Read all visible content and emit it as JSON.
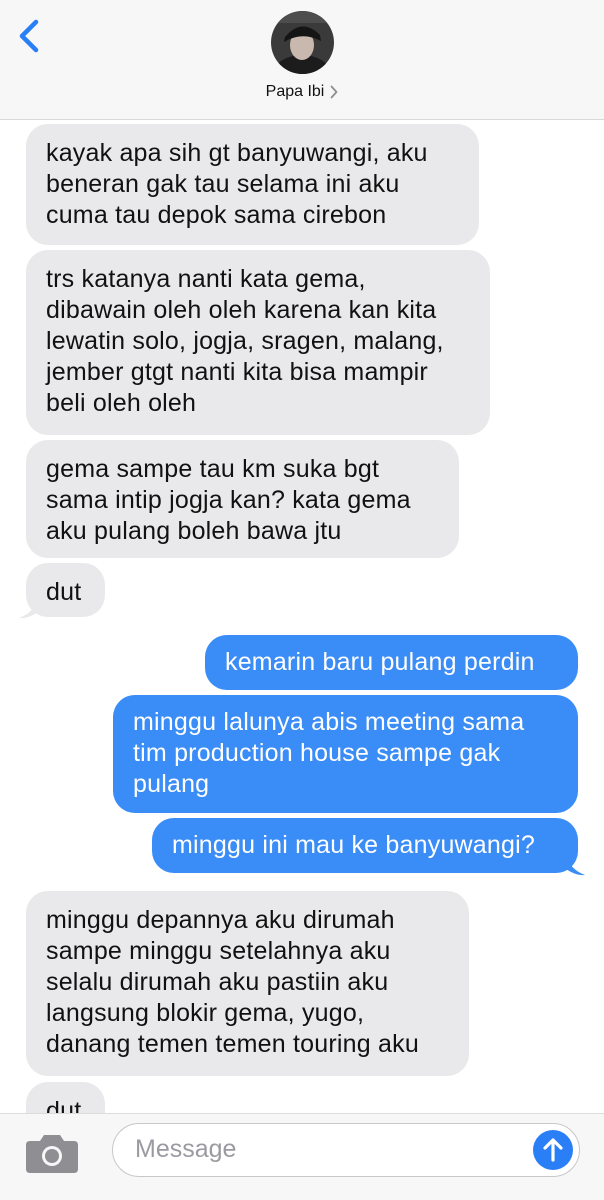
{
  "header": {
    "contact_name": "Papa Ibi",
    "back_icon": "chevron-left-icon",
    "accent": "#2a7ff6"
  },
  "messages": [
    {
      "dir": "in",
      "text": "kayak apa sih gt banyuwangi, aku\nbeneran gak tau selama ini aku\ncuma tau depok sama cirebon"
    },
    {
      "dir": "in",
      "text": "trs katanya nanti kata gema,\ndibawain oleh oleh karena kan kita\nlewatin solo, jogja, sragen, malang,\njember gtgt nanti kita bisa mampir\nbeli oleh oleh"
    },
    {
      "dir": "in",
      "text": "gema sampe tau km suka bgt\nsama intip jogja kan? kata gema\naku pulang boleh bawa jtu"
    },
    {
      "dir": "in",
      "text": "dut"
    },
    {
      "dir": "out",
      "text": "kemarin baru pulang perdin"
    },
    {
      "dir": "out",
      "text": "minggu lalunya abis meeting sama\ntim production house sampe gak\npulang"
    },
    {
      "dir": "out",
      "text": "minggu ini mau ke banyuwangi?"
    },
    {
      "dir": "in",
      "text": "minggu depannya aku dirumah\nsampe minggu setelahnya aku\nselalu dirumah aku pastiin aku\nlangsung blokir gema, yugo,\ndanang temen temen touring aku"
    },
    {
      "dir": "in",
      "text": "dut"
    }
  ],
  "composer": {
    "placeholder": "Message",
    "camera_icon": "camera-icon",
    "send_icon": "send-arrow-up-icon"
  },
  "colors": {
    "incoming_bubble": "#e9e9eb",
    "outgoing_bubble": "#3a8cf7"
  }
}
